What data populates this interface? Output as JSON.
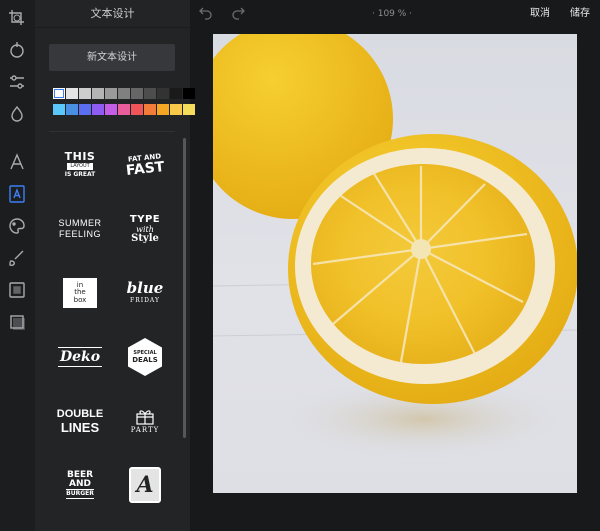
{
  "rail": {
    "items": [
      {
        "name": "crop-icon"
      },
      {
        "name": "brightness-icon"
      },
      {
        "name": "adjust-sliders-icon"
      },
      {
        "name": "drop-icon"
      },
      {
        "name": "text-icon"
      },
      {
        "name": "text-design-icon"
      },
      {
        "name": "paint-palette-icon"
      },
      {
        "name": "brush-icon"
      },
      {
        "name": "overlay-icon"
      },
      {
        "name": "frame-icon"
      }
    ],
    "active_index": 5
  },
  "panel": {
    "title": "文本设计",
    "new_button": "新文本设计",
    "swatches_row1": [
      "#ffffff",
      "#e5e5e5",
      "#cdcdcd",
      "#b4b4b4",
      "#9a9a9a",
      "#808080",
      "#666666",
      "#4d4d4d",
      "#333333",
      "#1a1a1a",
      "#000000"
    ],
    "swatches_row2": [
      "#5ac8fa",
      "#4a90e2",
      "#5b6ef0",
      "#8e5cf2",
      "#c55ee6",
      "#e85d9c",
      "#f0555a",
      "#f27c3a",
      "#f5a623",
      "#f8c84a",
      "#f3dd5b"
    ],
    "selected_swatch": 0
  },
  "designs": {
    "this_layout": {
      "line1": "THIS",
      "line2": "LAYOUT",
      "line3": "IS GREAT"
    },
    "fat_and_fast": {
      "line1": "FAT AND",
      "line2": "FAST"
    },
    "summer_feeling": {
      "line1": "SUMMER",
      "line2": "FEELING"
    },
    "type_with_style": {
      "line1": "TYPE",
      "line2": "with",
      "line3": "Style"
    },
    "in_the_box": {
      "line1": "in",
      "line2": "the",
      "line3": "box"
    },
    "blue_friday": {
      "line1": "blue",
      "line2": "FRIDAY"
    },
    "deko": {
      "line1": "Deko"
    },
    "special_deals": {
      "line1": "SPECIAL",
      "line2": "DEALS"
    },
    "double_lines": {
      "line1": "DOUBLE",
      "line2": "LINES"
    },
    "party": {
      "line1": "PARTY"
    },
    "beer_and_burger": {
      "line1": "BEER",
      "line2": "AND",
      "line3": "BURGER"
    },
    "a_badge": {
      "line1": "A"
    }
  },
  "toolbar": {
    "undo_icon": "undo-icon",
    "redo_icon": "redo-icon",
    "zoom": "· 109 % ·",
    "cancel": "取消",
    "save": "储存"
  },
  "canvas": {
    "image": "lemon-photo"
  }
}
